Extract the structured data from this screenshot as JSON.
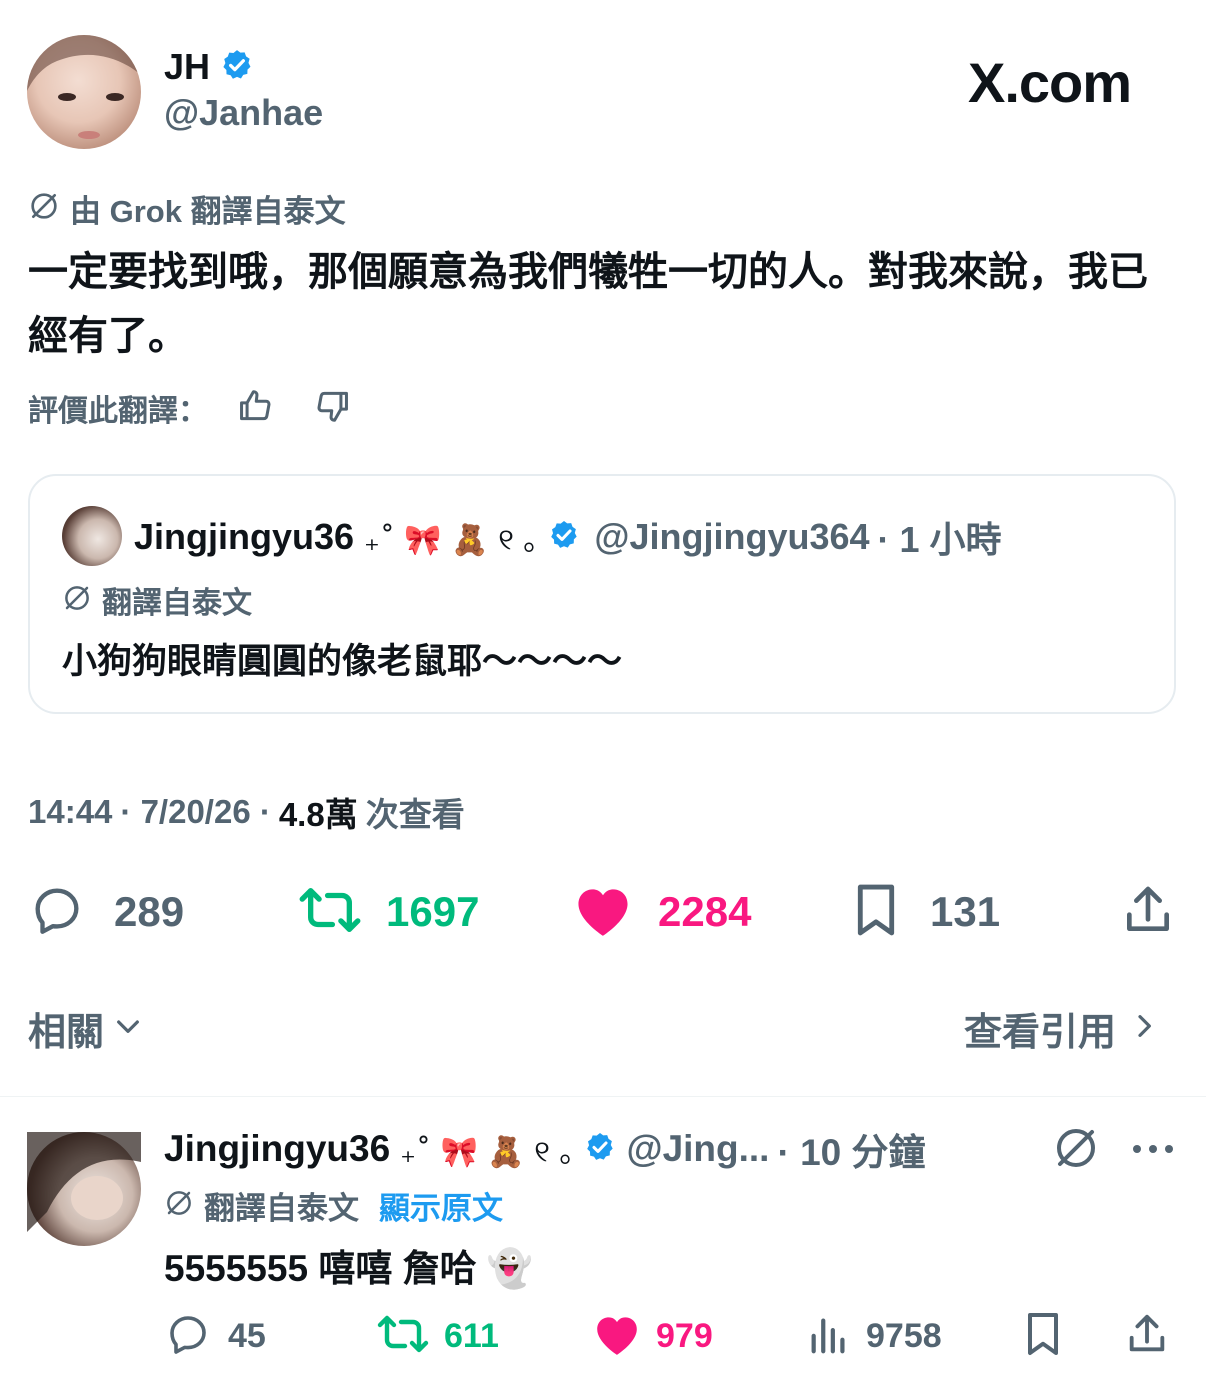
{
  "author": {
    "name": "JH",
    "handle": "@Janhae"
  },
  "brand": "X.com",
  "translation": {
    "label": "由 Grok 翻譯自泰文",
    "text": "一定要找到哦，那個願意為我們犧牲一切的人。對我來說，我已經有了。",
    "rate_label": "評價此翻譯："
  },
  "quote": {
    "name": "Jingjingyu36",
    "name_decor": "₊˚ 🎀 🧸 ୧ ｡",
    "handle": "@Jingjingyu364",
    "time": "· 1 小時",
    "translation_label": "翻譯自泰文",
    "text": "小狗狗眼睛圓圓的像老鼠耶～～～～"
  },
  "meta": {
    "time": "14:44",
    "date": "· 7/20/26 ·",
    "views": "4.8萬",
    "views_label": "次查看"
  },
  "stats": {
    "replies": "289",
    "retweets": "1697",
    "likes": "2284",
    "bookmarks": "131"
  },
  "related": {
    "label": "相關",
    "view_quotes": "查看引用"
  },
  "reply": {
    "name": "Jingjingyu36",
    "name_decor": "₊˚ 🎀 🧸 ୧ ｡",
    "handle": "@Jing...",
    "time": "· 10 分鐘",
    "translation_label": "翻譯自泰文",
    "show_original": "顯示原文",
    "text": "5555555 嘻嘻 詹哈 👻",
    "stats": {
      "replies": "45",
      "retweets": "611",
      "likes": "979",
      "views": "9758"
    }
  },
  "colors": {
    "verified": "#1d9bf0",
    "retweet": "#00ba7c",
    "like": "#f91880",
    "muted": "#536471",
    "link": "#1d9bf0"
  }
}
